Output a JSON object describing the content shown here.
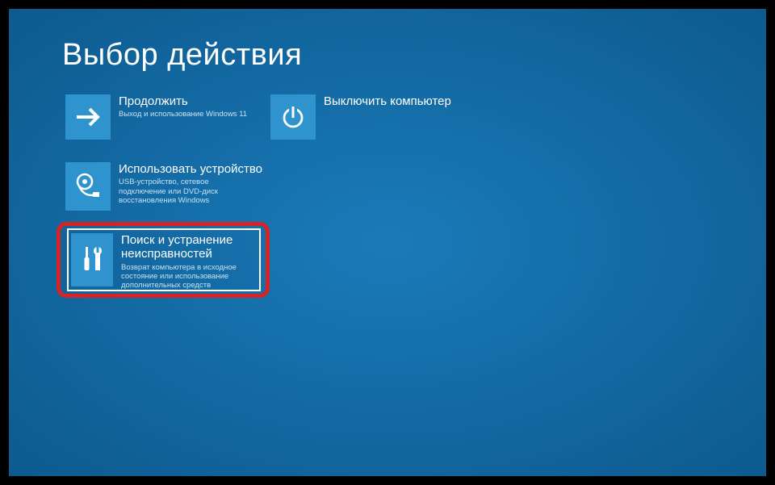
{
  "title": "Выбор действия",
  "options": {
    "continue": {
      "title": "Продолжить",
      "desc": "Выход и использование Windows 11"
    },
    "use_device": {
      "title": "Использовать устройство",
      "desc": "USB-устройство, сетевое подключение или DVD-диск восстановления Windows"
    },
    "troubleshoot": {
      "title": "Поиск и устранение неисправностей",
      "desc": "Возврат компьютера в исходное состояние или использование дополнительных средств"
    },
    "shutdown": {
      "title": "Выключить компьютер",
      "desc": ""
    }
  }
}
